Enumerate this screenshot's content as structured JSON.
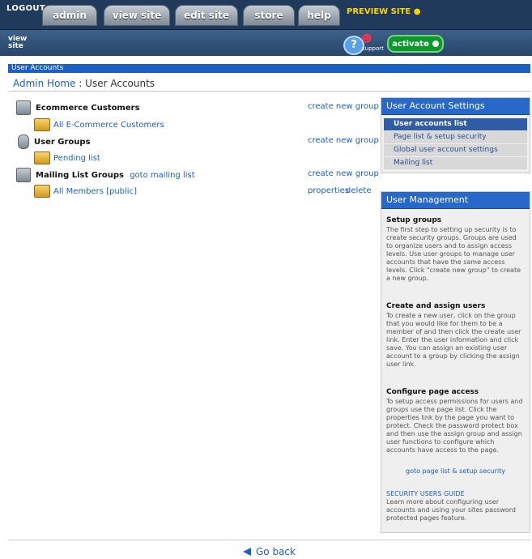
{
  "top": {
    "logout": "LOGOUT",
    "tabs": [
      "admin",
      "view site",
      "edit site",
      "store",
      "help"
    ],
    "preview": "PREVIEW SITE",
    "view_site_icon_label": "view site",
    "support_label": "support",
    "activate": "activate"
  },
  "page": {
    "bar_title": "User Accounts",
    "breadcrumb_home": "Admin Home",
    "breadcrumb_sep": " : ",
    "breadcrumb_current": "User Accounts"
  },
  "groups": [
    {
      "title": "Ecommerce Customers",
      "action": "create new group",
      "item": "All E-Commerce Customers"
    },
    {
      "title": "User Groups",
      "action": "create new group",
      "item": "Pending list"
    },
    {
      "title": "Mailing List Groups",
      "extra": "goto mailing list",
      "action": "create new group",
      "item": "All Members [public]",
      "item_actions": [
        "properties",
        "delete"
      ]
    }
  ],
  "settings_panel": {
    "title": "User Account Settings",
    "items": [
      "User accounts list",
      "Page list & setup security",
      "Global user account settings",
      "Mailing list"
    ]
  },
  "management_panel": {
    "title": "User Management",
    "sections": [
      {
        "heading": "Setup groups",
        "text": "The first step to setting up security is to create security groups. Groups are used to organize users and to assign access levels. Use user groups to manage user accounts that have the same access levels. Click \"create new group\" to create a new group."
      },
      {
        "heading": "Create and assign users",
        "text": "To create a new user, click on the group that you would like for them to be a member of and then click the create user link. Enter the user information and click save. You can assign an existing user account to a group by clicking the assign user link."
      },
      {
        "heading": "Configure page access",
        "text": "To setup access permissions for users and groups use the page list. Click the properties link by the page you want to protect. Check the password protect box and then use the assign group and assign user functions to configure which accounts have access to the page."
      }
    ],
    "page_link": "goto page list & setup security",
    "guide_title": "SECURITY USERS GUIDE",
    "guide_text": "Learn more about configuring user accounts and using your sites password protected pages feature."
  },
  "footer": {
    "goback": "Go back"
  }
}
